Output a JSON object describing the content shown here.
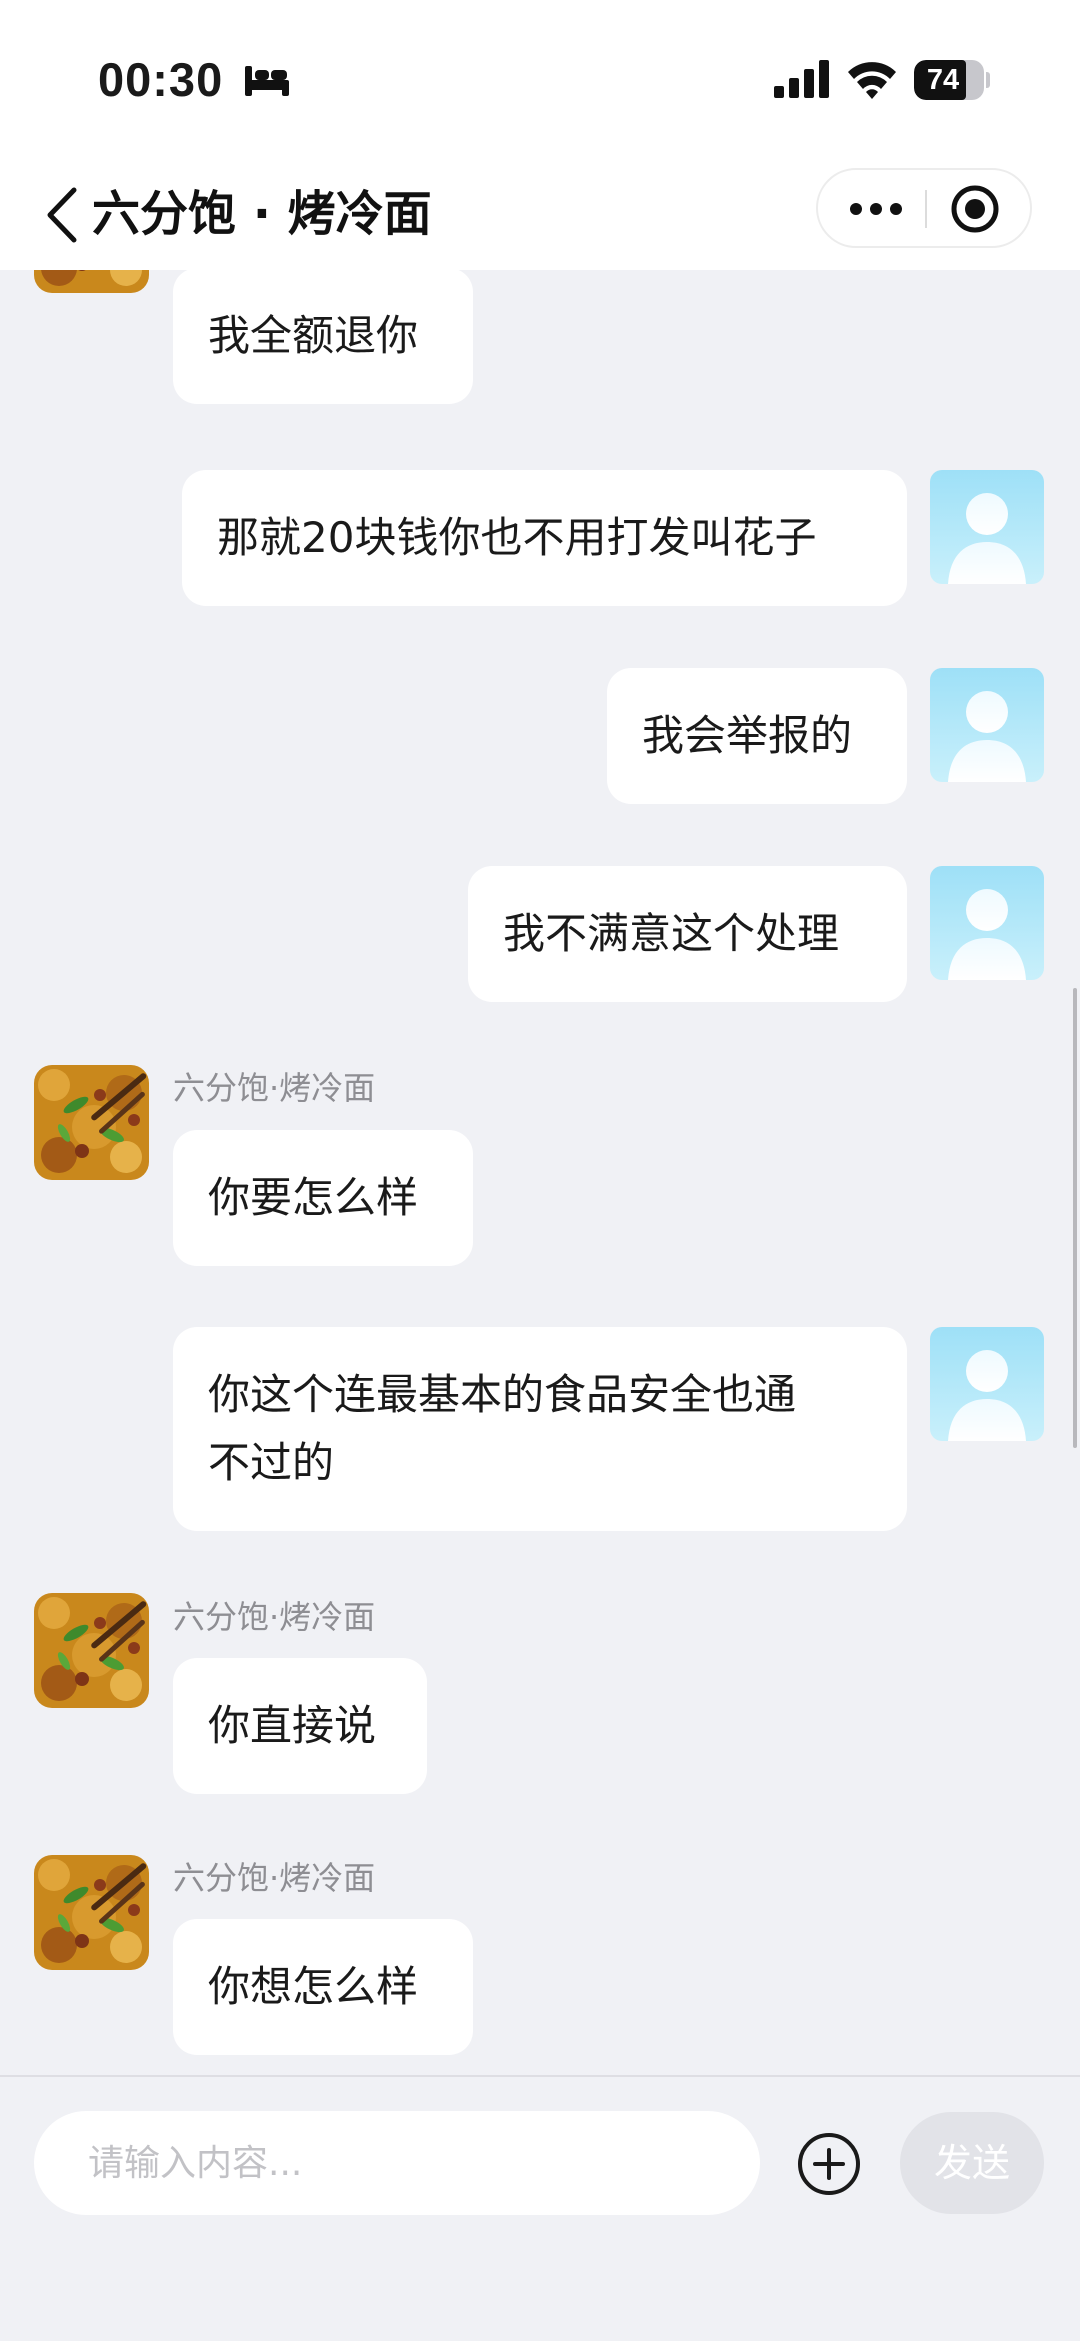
{
  "status_bar": {
    "time": "00:30",
    "mode_icon": "bed-icon",
    "battery_level": "74",
    "battery_fraction": 0.74
  },
  "nav": {
    "title": "六分饱 · 烤冷面",
    "back_icon": "chevron-left-icon",
    "more_icon": "more-dots-icon",
    "target_icon": "record-target-icon"
  },
  "chat": {
    "messages": [
      {
        "from": "merchant",
        "name": "",
        "text": "我全额退你"
      },
      {
        "from": "user",
        "text": "那就20块钱你也不用打发叫花子"
      },
      {
        "from": "user",
        "text": "我会举报的"
      },
      {
        "from": "user",
        "text": "我不满意这个处理"
      },
      {
        "from": "merchant",
        "name": "六分饱·烤冷面",
        "text": "你要怎么样"
      },
      {
        "from": "user",
        "text": "你这个连最基本的食品安全也通不过的",
        "line1": "你这个连最基本的食品安全也通",
        "line2": "不过的"
      },
      {
        "from": "merchant",
        "name": "六分饱·烤冷面",
        "text": "你直接说"
      },
      {
        "from": "merchant",
        "name": "六分饱·烤冷面",
        "text": "你想怎么样"
      }
    ]
  },
  "input_bar": {
    "placeholder": "请输入内容...",
    "plus_icon": "plus-circle-icon",
    "send_label": "发送"
  },
  "colors": {
    "background": "#f0f1f5",
    "bubble": "#ffffff",
    "send_disabled": "#e2e3e8",
    "user_avatar": "#a8e4f8"
  }
}
